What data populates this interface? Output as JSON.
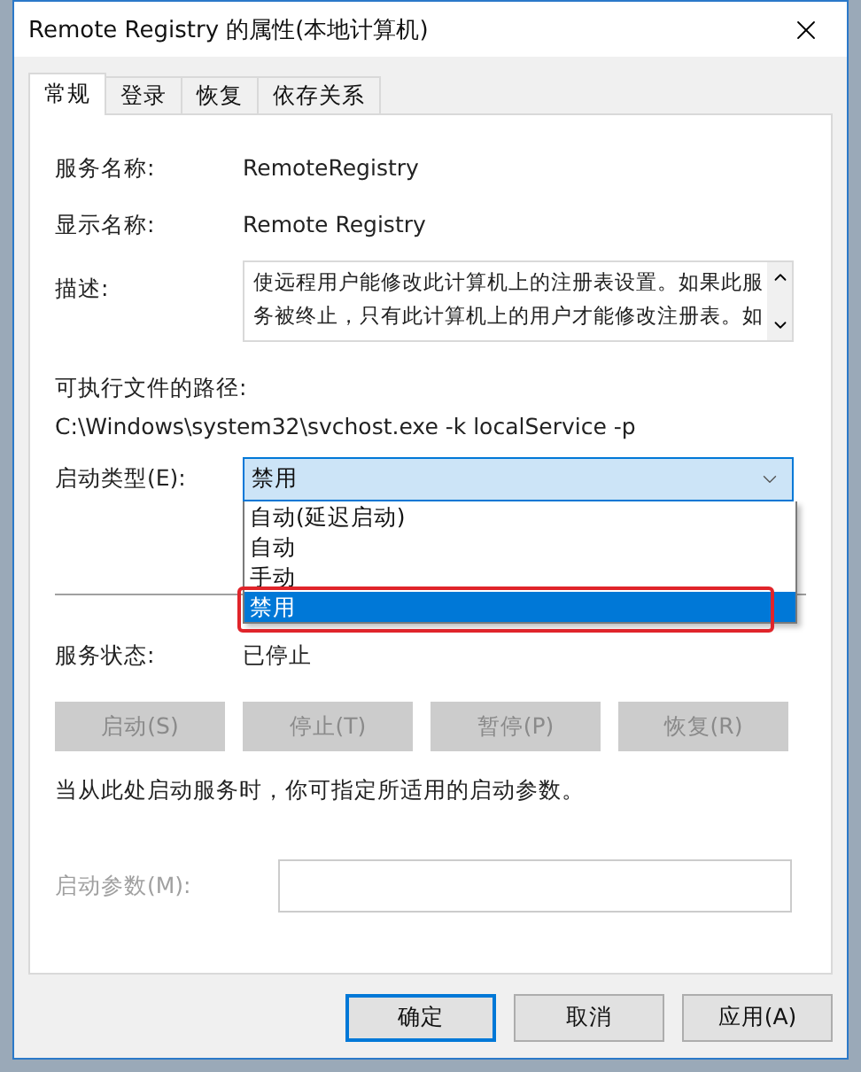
{
  "window": {
    "title": "Remote Registry 的属性(本地计算机)"
  },
  "tabs": [
    {
      "label": "常规",
      "selected": true
    },
    {
      "label": "登录",
      "selected": false
    },
    {
      "label": "恢复",
      "selected": false
    },
    {
      "label": "依存关系",
      "selected": false
    }
  ],
  "service_name": {
    "label": "服务名称:",
    "value": "RemoteRegistry"
  },
  "display_name": {
    "label": "显示名称:",
    "value": "Remote Registry"
  },
  "description": {
    "label": "描述:",
    "lines": [
      "使远程用户能修改此计算机上的注册表设置。如果此服",
      "务被终止，只有此计算机上的用户才能修改注册表。如"
    ]
  },
  "path": {
    "label": "可执行文件的路径:",
    "value": "C:\\Windows\\system32\\svchost.exe -k localService -p"
  },
  "startup_type": {
    "label": "启动类型(E):",
    "value": "禁用",
    "expanded": true,
    "options": [
      {
        "label": "自动(延迟启动)",
        "selected": false,
        "marked": false
      },
      {
        "label": "自动",
        "selected": false,
        "marked": false
      },
      {
        "label": "手动",
        "selected": false,
        "marked": false
      },
      {
        "label": "禁用",
        "selected": true,
        "marked": true
      }
    ]
  },
  "service_status": {
    "label": "服务状态:",
    "value": "已停止"
  },
  "service_buttons": [
    {
      "label": "启动(S)",
      "disabled": true
    },
    {
      "label": "停止(T)",
      "disabled": true
    },
    {
      "label": "暂停(P)",
      "disabled": true
    },
    {
      "label": "恢复(R)",
      "disabled": true
    }
  ],
  "hint": "当从此处启动服务时，你可指定所适用的启动参数。",
  "start_params": {
    "label": "启动参数(M):",
    "disabled": true
  },
  "dialog_buttons": [
    {
      "label": "确定",
      "default": true
    },
    {
      "label": "取消",
      "default": false
    },
    {
      "label": "应用(A)",
      "default": false
    }
  ]
}
